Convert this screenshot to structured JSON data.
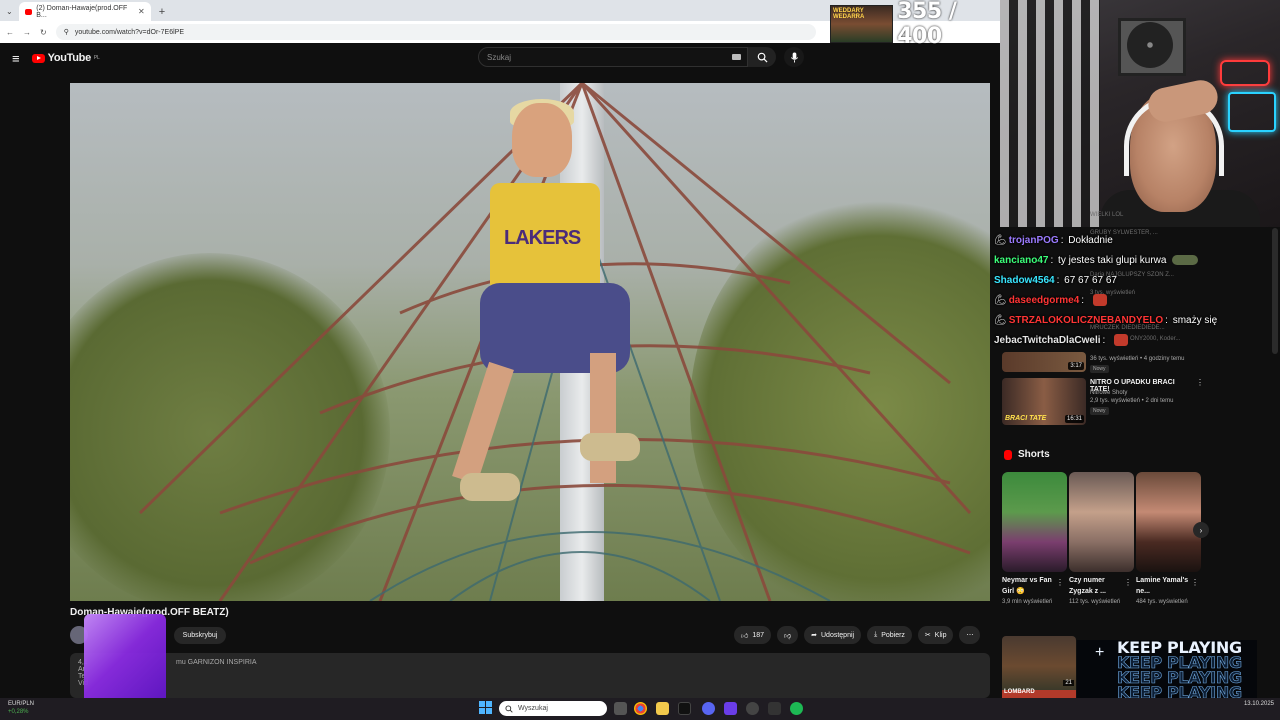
{
  "browser": {
    "tab_title": "(2) Doman-Hawaje(prod.OFF B...",
    "url": "youtube.com/watch?v=dOr-7E6lPE",
    "new_tab": "+"
  },
  "youtube": {
    "logo_text": "YouTube",
    "logo_country": "PL",
    "search_placeholder": "Szukaj"
  },
  "video": {
    "title": "Doman-Hawaje(prod.OFF BEATZ)",
    "jersey_text": "LAKERS",
    "subscribe_label": "Subskrybuj",
    "like_count": "187",
    "share_label": "Udostępnij",
    "download_label": "Pobierz",
    "clip_label": "Klip",
    "description_stats": "4,1",
    "description_tag": "mu GARNIZON INSPIRIA",
    "description_lines": [
      "Ar",
      "Te",
      "Vid"
    ]
  },
  "stream": {
    "counter": "355 / 400",
    "counter_thumb_text": "WEDDARY WEDARRA",
    "keep_playing_lines": [
      "KEEP PLAYING",
      "KEEP PLAYING",
      "KEEP PLAYING",
      "KEEP PLAYING"
    ],
    "plus": "+"
  },
  "chat": [
    {
      "user": "trojanPOG",
      "msg": "Dokładnie",
      "color": "#9b7bff",
      "icon": true
    },
    {
      "user": "kanciano47",
      "msg": "ty jestes taki glupi kurwa",
      "color": "#3cff7a",
      "icon": false,
      "emote": true
    },
    {
      "user": "Shadow4564",
      "msg": "67 67 67 67",
      "color": "#39e6ff",
      "icon": false
    },
    {
      "user": "daseedgorme4",
      "msg": "",
      "color": "#ff3535",
      "icon": true,
      "emoteR": true
    },
    {
      "user": "STRZALOKOLICZNEBANDYELO",
      "msg": "smaży się",
      "color": "#ff3535",
      "icon": true
    },
    {
      "user": "JebacTwitchaDlaCweli",
      "msg": "",
      "color": "#e6e6e6",
      "icon": false,
      "emoteR": true
    }
  ],
  "chat_ghost": [
    "GRUBY SYLWESTER, ...",
    "Daria NAJGLUPSZY SZON Z...",
    "3 tys. wyświetleń",
    "MRUCZEK DIEDIEDIEDE...",
    "WIELKI LOL",
    "ONY2000, Koder..."
  ],
  "recommendations": [
    {
      "title": "",
      "channel": "",
      "stats": "36 tys. wyświetleń • 4 godziny temu",
      "badge": "Nowy",
      "duration": "3:17"
    },
    {
      "title": "NITRO O UPADKU BRACI TATE!",
      "channel": "Nitrowe Shoty",
      "stats": "2,9 tys. wyświetleń • 2 dni temu",
      "badge": "Nowy",
      "duration": "16:31",
      "thumb_text": "BRACI TATE"
    }
  ],
  "shorts": {
    "header": "Shorts",
    "items": [
      {
        "title": "Neymar vs Fan Girl 😳",
        "views": "3,9 mln wyświetleń"
      },
      {
        "title": "Czy numer Zygzak z ...",
        "views": "112 tys. wyświetleń"
      },
      {
        "title": "Lamine Yamal's ne...",
        "views": "484 tys. wyświetleń"
      }
    ]
  },
  "bottom_rec_duration": "21",
  "bottom_rec_text": "LOMBARD",
  "taskbar": {
    "ticker_pair": "EUR/PLN",
    "ticker_change": "+0,28%",
    "search_placeholder": "Wyszukaj",
    "tray_time": "",
    "tray_date": "13.10.2025"
  },
  "colors": {
    "yt_red": "#ff0000",
    "background": "#0f0f0f",
    "chip": "#272727"
  }
}
